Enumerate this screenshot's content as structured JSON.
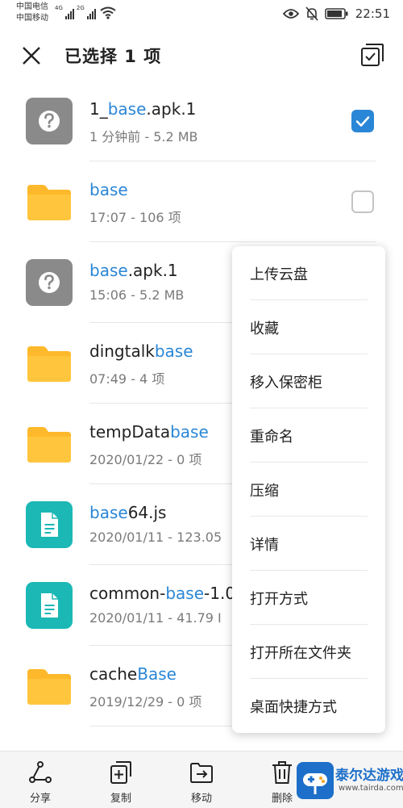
{
  "status_bar": {
    "carrier_1": "中国电信",
    "carrier_2": "中国移动",
    "net_1": "4G",
    "net_2": "2G",
    "time": "22:51",
    "icons": [
      "wifi-icon",
      "eye-icon",
      "bell-off-icon",
      "battery-icon"
    ]
  },
  "app_bar": {
    "title": "已选择 1 项",
    "close_icon": "close-icon",
    "select_all_icon": "select-all-icon"
  },
  "files": [
    {
      "name_parts": [
        "1_",
        "base",
        ".apk.1"
      ],
      "meta": "1 分钟前 - 5.2 MB",
      "type": "unknown",
      "checked": true
    },
    {
      "name_parts": [
        "",
        "base",
        ""
      ],
      "meta": "17:07 - 106 项",
      "type": "folder",
      "checked": false
    },
    {
      "name_parts": [
        "",
        "base",
        ".apk.1"
      ],
      "meta": "15:06 - 5.2 MB",
      "type": "unknown",
      "checked": null
    },
    {
      "name_parts": [
        "dingtalk",
        "base",
        ""
      ],
      "meta": "07:49 - 4 项",
      "type": "folder",
      "checked": null
    },
    {
      "name_parts": [
        "tempData",
        "base",
        ""
      ],
      "meta": "2020/01/22 - 0 项",
      "type": "folder",
      "checked": null
    },
    {
      "name_parts": [
        "",
        "base",
        "64.js"
      ],
      "meta": "2020/01/11 - 123.05",
      "type": "doc",
      "checked": null
    },
    {
      "name_parts": [
        "common-",
        "base",
        "-1.0"
      ],
      "meta": "2020/01/11 - 41.79 I",
      "type": "doc",
      "checked": null
    },
    {
      "name_parts": [
        "cache",
        "Base",
        ""
      ],
      "meta": "2019/12/29 - 0 项",
      "type": "folder",
      "checked": null
    }
  ],
  "context_menu": {
    "items": [
      "上传云盘",
      "收藏",
      "移入保密柜",
      "重命名",
      "压缩",
      "详情",
      "打开方式",
      "打开所在文件夹",
      "桌面快捷方式"
    ]
  },
  "bottom_bar": {
    "items": [
      {
        "label": "分享",
        "icon": "share-icon"
      },
      {
        "label": "复制",
        "icon": "copy-icon"
      },
      {
        "label": "移动",
        "icon": "move-icon"
      },
      {
        "label": "删除",
        "icon": "delete-icon"
      }
    ]
  },
  "watermark": {
    "text": "泰尔达游戏网",
    "url": "www.tairda.com"
  },
  "colors": {
    "accent": "#2a86d6",
    "folder": "#fdb92b",
    "unknown_file": "#8a8a8a",
    "doc_file": "#1bb8b5"
  }
}
